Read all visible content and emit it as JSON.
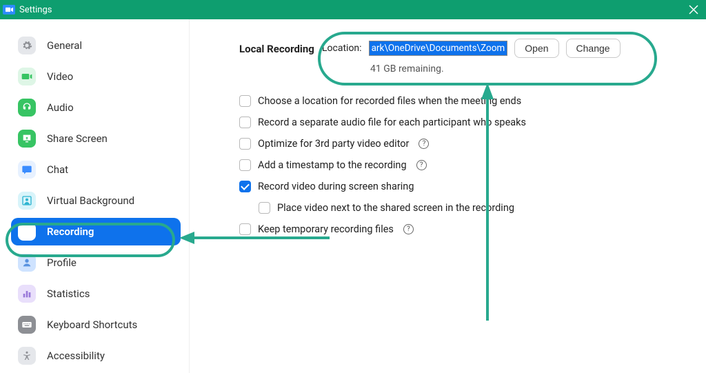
{
  "window": {
    "title": "Settings"
  },
  "sidebar": {
    "items": [
      {
        "label": "General",
        "icon": "gear",
        "color": "#e5e7eb",
        "fg": "#8d8f94"
      },
      {
        "label": "Video",
        "icon": "video",
        "color": "#def6e6",
        "fg": "#37c463"
      },
      {
        "label": "Audio",
        "icon": "audio",
        "color": "#37c463",
        "fg": "#ffffff"
      },
      {
        "label": "Share Screen",
        "icon": "share",
        "color": "#37c463",
        "fg": "#ffffff"
      },
      {
        "label": "Chat",
        "icon": "chat",
        "color": "#e7f1ff",
        "fg": "#3a8cff"
      },
      {
        "label": "Virtual Background",
        "icon": "vb",
        "color": "#d8f4fa",
        "fg": "#2bb3d0"
      },
      {
        "label": "Recording",
        "icon": "record",
        "color": "#ffffff",
        "fg": "#ffffff",
        "active": true
      },
      {
        "label": "Profile",
        "icon": "profile",
        "color": "#cfe3ff",
        "fg": "#5a93e0"
      },
      {
        "label": "Statistics",
        "icon": "stats",
        "color": "#e9dffb",
        "fg": "#9a79d9"
      },
      {
        "label": "Keyboard Shortcuts",
        "icon": "keyboard",
        "color": "#8d8f94",
        "fg": "#ffffff"
      },
      {
        "label": "Accessibility",
        "icon": "accessibility",
        "color": "#e5e7eb",
        "fg": "#8d8f94"
      }
    ]
  },
  "main": {
    "section_title": "Local Recording",
    "location_label": "Location:",
    "location_path": "ark\\OneDrive\\Documents\\Zoom",
    "open_btn": "Open",
    "change_btn": "Change",
    "remaining": "41 GB remaining.",
    "options": [
      {
        "label": "Choose a location for recorded files when the meeting ends",
        "checked": false
      },
      {
        "label": "Record a separate audio file for each participant who speaks",
        "checked": false
      },
      {
        "label": "Optimize for 3rd party video editor",
        "checked": false,
        "help": true
      },
      {
        "label": "Add a timestamp to the recording",
        "checked": false,
        "help": true
      },
      {
        "label": "Record video during screen sharing",
        "checked": true
      },
      {
        "label": "Place video next to the shared screen in the recording",
        "checked": false,
        "indent": true
      },
      {
        "label": "Keep temporary recording files",
        "checked": false,
        "help": true
      }
    ]
  }
}
